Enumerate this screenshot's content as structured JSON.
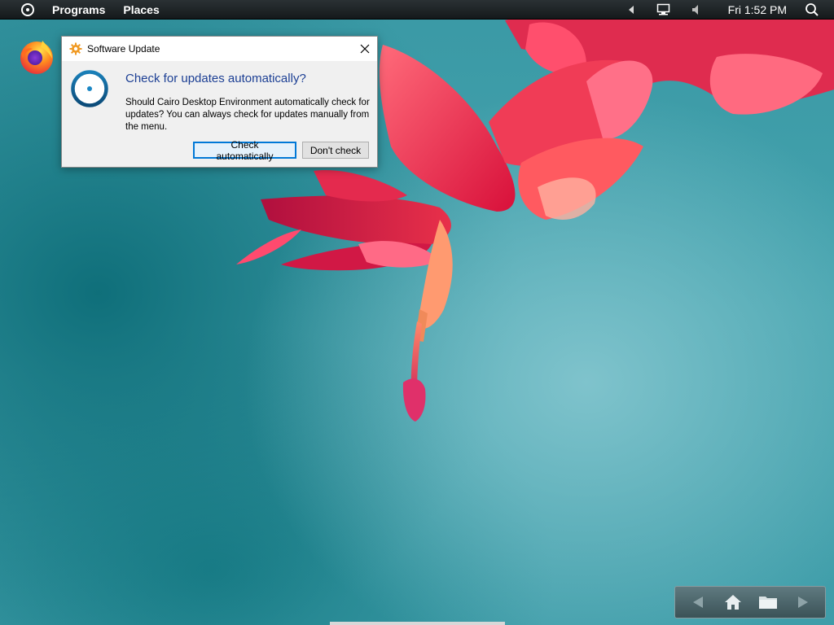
{
  "menubar": {
    "items": [
      "Programs",
      "Places"
    ],
    "clock": "Fri 1:52 PM",
    "icons": [
      "cairo-logo-icon",
      "tray-expand-icon",
      "network-icon",
      "volume-icon",
      "search-icon"
    ]
  },
  "desktop_icons": [
    {
      "name": "firefox-icon"
    }
  ],
  "dialog": {
    "title": "Software Update",
    "heading": "Check for updates automatically?",
    "message": "Should Cairo Desktop Environment automatically check for updates? You can always check for updates manually from the menu.",
    "buttons": {
      "primary": "Check automatically",
      "secondary": "Don't check"
    }
  },
  "dock": {
    "icons": [
      "back-arrow-icon",
      "home-icon",
      "folder-icon",
      "forward-arrow-icon"
    ]
  },
  "colors": {
    "accent": "#0078d7",
    "heading": "#1c3f94",
    "menubar": "#1b2022"
  }
}
